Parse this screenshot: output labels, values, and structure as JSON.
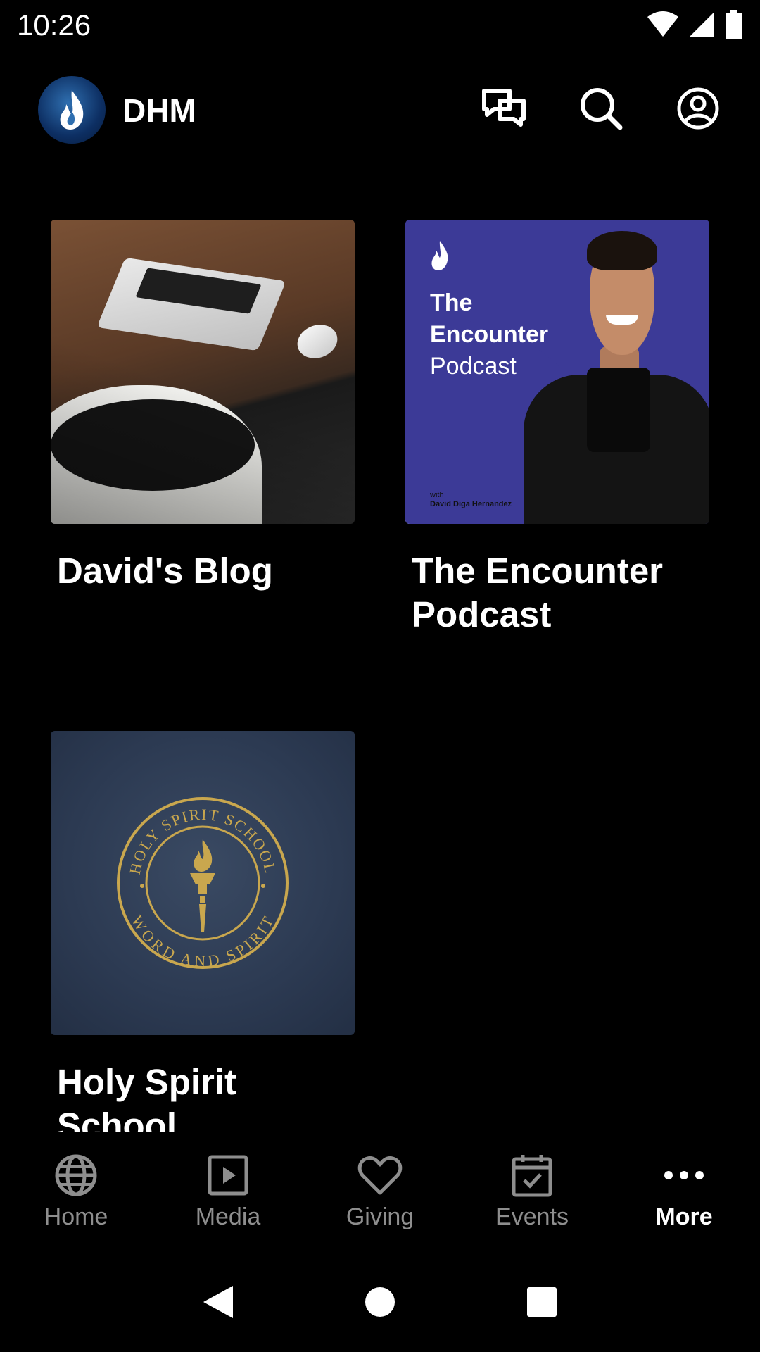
{
  "status_bar": {
    "time": "10:26",
    "icons": [
      "wifi-icon",
      "cellular-signal-icon",
      "battery-icon"
    ]
  },
  "header": {
    "title": "DHM",
    "actions": [
      "chat-icon",
      "search-icon",
      "profile-icon"
    ]
  },
  "cards": [
    {
      "title": "David's Blog",
      "image": "laptop-desk-photo"
    },
    {
      "title": "The Encounter Podcast",
      "image": "podcast-cover",
      "cover_text": {
        "line1": "The",
        "line2": "Encounter",
        "line3": "Podcast",
        "with": "with",
        "host": "David Diga Hernandez"
      }
    },
    {
      "title": "Holy Spirit School",
      "image": "school-seal",
      "seal_top": "HOLY SPIRIT SCHOOL",
      "seal_bottom": "WORD AND SPIRIT"
    }
  ],
  "bottom_nav": [
    {
      "label": "Home",
      "icon": "globe-icon",
      "active": false
    },
    {
      "label": "Media",
      "icon": "play-icon",
      "active": false
    },
    {
      "label": "Giving",
      "icon": "heart-icon",
      "active": false
    },
    {
      "label": "Events",
      "icon": "calendar-check-icon",
      "active": false
    },
    {
      "label": "More",
      "icon": "more-dots-icon",
      "active": true
    }
  ],
  "colors": {
    "background": "#000000",
    "inactive_nav": "#8e8e8e",
    "podcast_purple": "#3c3a97",
    "seal_gold": "#c9a74e"
  }
}
